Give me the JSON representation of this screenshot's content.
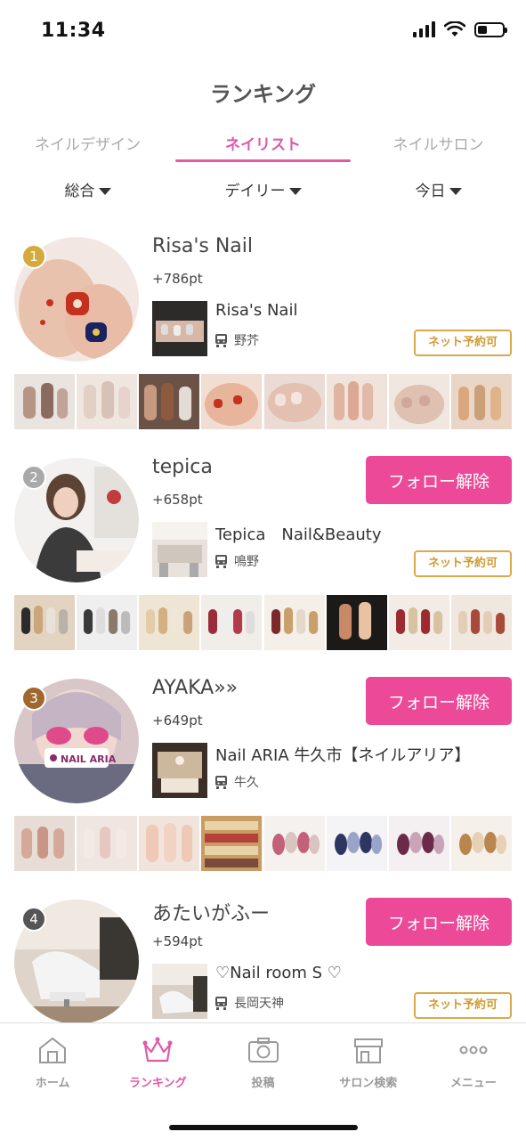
{
  "status_bar": {
    "time": "11:34"
  },
  "header": {
    "title": "ランキング"
  },
  "tabs": [
    {
      "label": "ネイルデザイン",
      "active": false
    },
    {
      "label": "ネイリスト",
      "active": true
    },
    {
      "label": "ネイルサロン",
      "active": false
    }
  ],
  "filters": [
    {
      "label": "総合"
    },
    {
      "label": "デイリー"
    },
    {
      "label": "今日"
    }
  ],
  "colors": {
    "accent": "#e05aa6",
    "follow_button": "#ec4a98",
    "reserve_border": "#dba94a"
  },
  "rankings": [
    {
      "rank": "1",
      "rank_color": "#d4aa3c",
      "name": "Risa's Nail",
      "points": "+786pt",
      "follow_label": "",
      "salon": {
        "name": "Risa's Nail",
        "station": "野芥",
        "reserve_label": "ネット予約可"
      }
    },
    {
      "rank": "2",
      "rank_color": "#a9a9a9",
      "name": "tepica",
      "points": "+658pt",
      "follow_label": "フォロー解除",
      "salon": {
        "name": "Tepica　Nail&Beauty",
        "station": "鳴野",
        "reserve_label": "ネット予約可"
      }
    },
    {
      "rank": "3",
      "rank_color": "#a0682e",
      "name": "AYAKA»»",
      "points": "+649pt",
      "follow_label": "フォロー解除",
      "salon": {
        "name": "Nail ARIA 牛久市【ネイルアリア】",
        "station": "牛久",
        "reserve_label": ""
      }
    },
    {
      "rank": "4",
      "rank_color": "#555555",
      "name": "あたいがふー",
      "points": "+594pt",
      "follow_label": "フォロー解除",
      "salon": {
        "name": "♡Nail room S ♡",
        "station": "長岡天神",
        "reserve_label": "ネット予約可"
      }
    }
  ],
  "tab_bar": [
    {
      "label": "ホーム",
      "icon": "home-icon",
      "active": false
    },
    {
      "label": "ランキング",
      "icon": "crown-icon",
      "active": true
    },
    {
      "label": "投稿",
      "icon": "camera-icon",
      "active": false
    },
    {
      "label": "サロン検索",
      "icon": "shop-icon",
      "active": false
    },
    {
      "label": "メニュー",
      "icon": "more-icon",
      "active": false
    }
  ]
}
